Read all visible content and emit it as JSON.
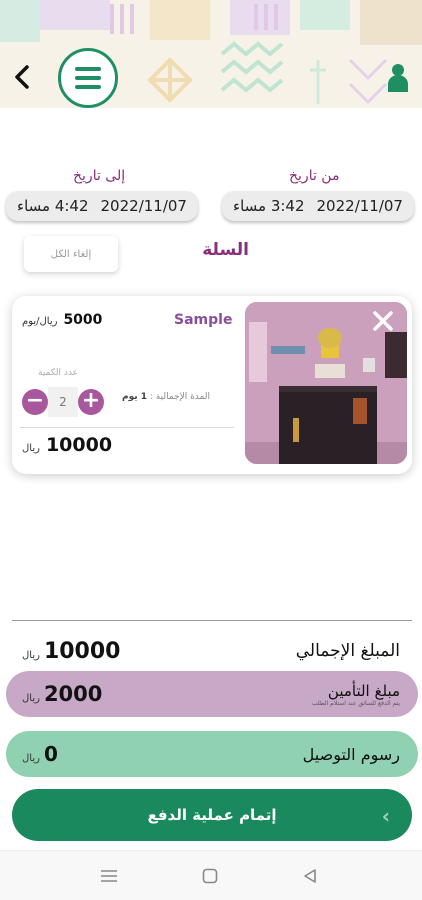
{
  "header": {
    "back_icon": "chevron-left-icon",
    "menu_icon": "hamburger-icon",
    "user_icon": "person-icon",
    "accent_color": "#1f8f63"
  },
  "dates": {
    "from_label": "من تاريخ",
    "from_date": "2022/11/07",
    "from_time": "3:42 مساء",
    "to_label": "إلى تاريخ",
    "to_date": "2022/11/07",
    "to_time": "4:42 مساء"
  },
  "basket": {
    "title": "السلة",
    "clear_all": "إلغاء الكل"
  },
  "item": {
    "name": "Sample",
    "price": "5000",
    "price_unit": "ريال/يوم",
    "qty_label": "عدد الكمية",
    "qty_minus": "−",
    "qty_value": "2",
    "qty_plus": "+",
    "duration_label": "المدة الإجمالية :",
    "duration_value": "1 يوم",
    "total": "10000",
    "total_unit": "ريال"
  },
  "summary": {
    "total_label": "المبلغ الإجمالي",
    "total_value": "10000",
    "total_unit": "ريال",
    "insurance_label": "مبلغ التأمين",
    "insurance_note": "يتم الدفع للسائق عند استلام الطلب",
    "insurance_value": "2000",
    "insurance_unit": "ريال",
    "delivery_label": "رسوم التوصيل",
    "delivery_value": "0",
    "delivery_unit": "ريال"
  },
  "checkout": {
    "label": "إتمام عملية الدفع"
  },
  "colors": {
    "purple_accent": "#8a2f7a",
    "insurance_bg": "#c7a8c6",
    "delivery_bg": "#8fd1b1",
    "pay_bg": "#1a8a5e"
  }
}
